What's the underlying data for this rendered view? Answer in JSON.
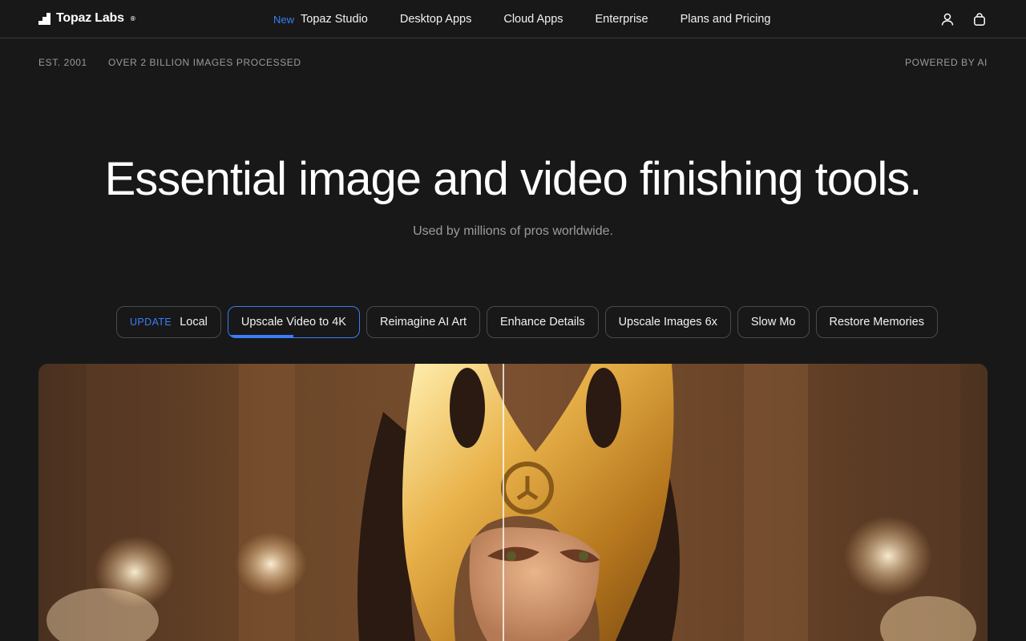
{
  "brand": {
    "name": "Topaz Labs",
    "reg": "®"
  },
  "nav": {
    "links": [
      {
        "tag": "New",
        "label": "Topaz Studio"
      },
      {
        "tag": "",
        "label": "Desktop Apps"
      },
      {
        "tag": "",
        "label": "Cloud Apps"
      },
      {
        "tag": "",
        "label": "Enterprise"
      },
      {
        "tag": "",
        "label": "Plans and Pricing"
      }
    ],
    "icons": [
      "user-icon",
      "shopping-bag-icon"
    ]
  },
  "subbar": {
    "established": "EST. 2001",
    "images": "OVER 2 BILLION IMAGES PROCESSED",
    "powered": "POWERED BY AI"
  },
  "hero": {
    "title": "Essential image and video finishing tools.",
    "subtitle": "Used by millions of pros worldwide."
  },
  "pills": [
    {
      "tag": "UPDATE",
      "label": "Local",
      "active": false
    },
    {
      "tag": "",
      "label": "Upscale Video to 4K",
      "active": true,
      "progress": 0.5
    },
    {
      "tag": "",
      "label": "Reimagine AI Art",
      "active": false
    },
    {
      "tag": "",
      "label": "Enhance Details",
      "active": false
    },
    {
      "tag": "",
      "label": "Upscale Images 6x",
      "active": false
    },
    {
      "tag": "",
      "label": "Slow Mo",
      "active": false
    },
    {
      "tag": "",
      "label": "Restore Memories",
      "active": false
    }
  ],
  "colors": {
    "background": "#181818",
    "accent": "#3b7df6",
    "muted_text": "#9c9c9c",
    "border": "#4a4a4a"
  },
  "showcase": {
    "subject": "before-after-comparison-image",
    "split_fraction": 0.49
  }
}
